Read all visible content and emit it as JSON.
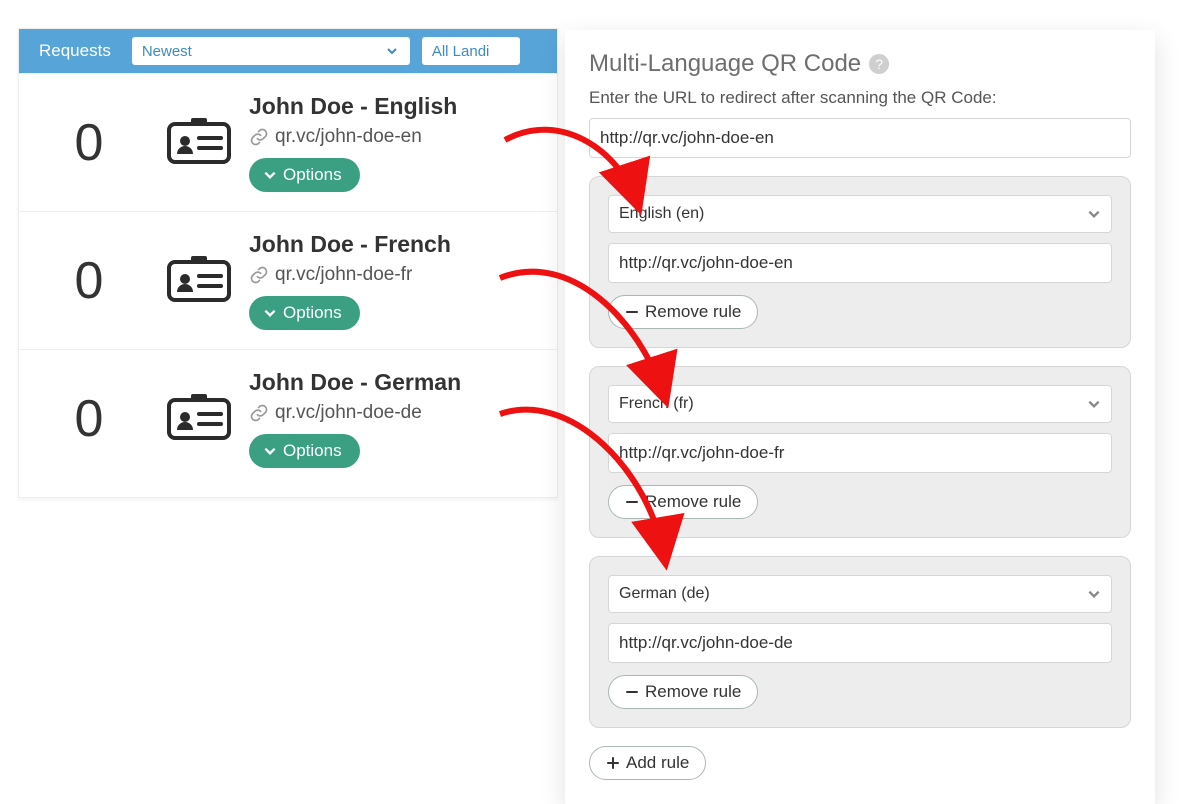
{
  "header": {
    "requests": "Requests",
    "sort": "Newest",
    "filter": "All Landi"
  },
  "list": [
    {
      "count": "0",
      "title": "John Doe - English",
      "link": "qr.vc/john-doe-en",
      "options": "Options"
    },
    {
      "count": "0",
      "title": "John Doe - French",
      "link": "qr.vc/john-doe-fr",
      "options": "Options"
    },
    {
      "count": "0",
      "title": "John Doe - German",
      "link": "qr.vc/john-doe-de",
      "options": "Options"
    }
  ],
  "panel": {
    "title": "Multi-Language QR Code",
    "subtitle": "Enter the URL to redirect after scanning the QR Code:",
    "default_url": "http://qr.vc/john-doe-en",
    "remove_label": "Remove rule",
    "add_label": "Add rule",
    "rules": [
      {
        "lang": "English (en)",
        "url": "http://qr.vc/john-doe-en"
      },
      {
        "lang": "French (fr)",
        "url": "http://qr.vc/john-doe-fr"
      },
      {
        "lang": "German (de)",
        "url": "http://qr.vc/john-doe-de"
      }
    ]
  }
}
